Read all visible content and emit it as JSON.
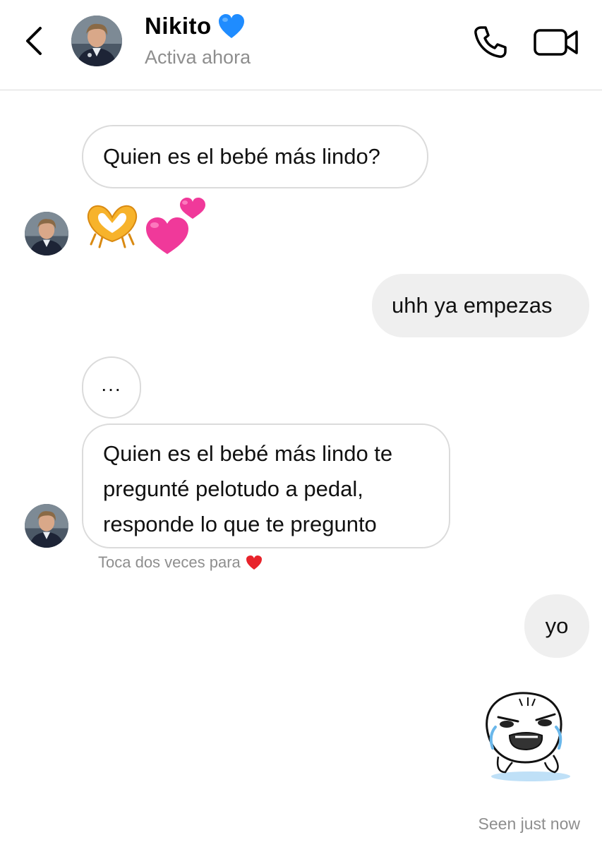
{
  "header": {
    "contact_name": "Nikito",
    "status": "Activa ahora",
    "back_icon": "chevron-left-icon",
    "call_icon": "phone-icon",
    "video_icon": "video-camera-icon",
    "name_badge_icon": "blue-heart-icon",
    "name_badge_color": "#1f8cff"
  },
  "messages": [
    {
      "sender": "contact",
      "type": "text",
      "text": "Quien es el bebé más lindo?"
    },
    {
      "sender": "contact",
      "type": "emoji",
      "icons": [
        "heart-hands-emoji",
        "two-hearts-emoji"
      ]
    },
    {
      "sender": "me",
      "type": "text",
      "text": "uhh ya empezas"
    },
    {
      "sender": "contact",
      "type": "text",
      "text": "..."
    },
    {
      "sender": "contact",
      "type": "text",
      "lines": [
        "Quien es el bebé más lindo te",
        "pregunté pelotudo a pedal,",
        "responde lo que te pregunto"
      ]
    },
    {
      "sender": "me",
      "type": "text",
      "text": "yo"
    },
    {
      "sender": "me",
      "type": "sticker",
      "icon": "crying-blob-sticker"
    }
  ],
  "hint": {
    "text": "Toca dos veces para",
    "icon": "red-heart-icon",
    "icon_color": "#e8232b"
  },
  "seen_text": "Seen just now",
  "colors": {
    "incoming_border": "#dbdbdb",
    "outgoing_bubble": "#efefef",
    "secondary_text": "#8e8e8e",
    "heart_pink": "#f0399a"
  }
}
